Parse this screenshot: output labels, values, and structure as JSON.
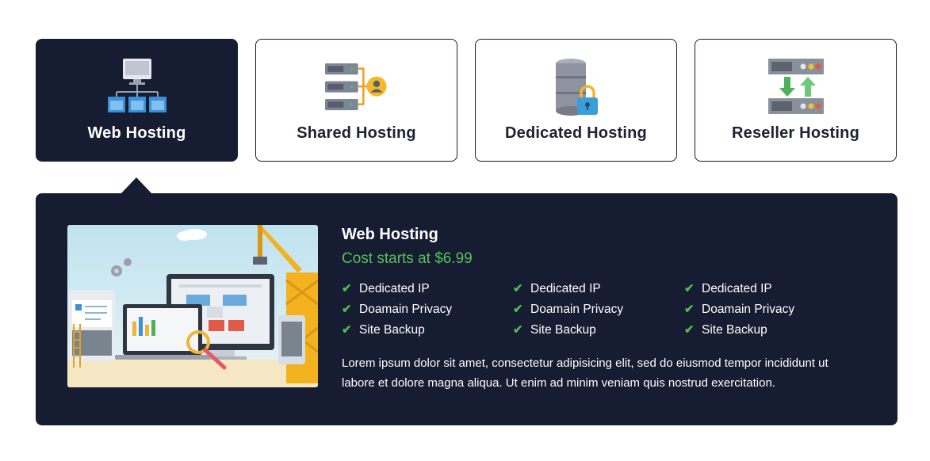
{
  "tabs": [
    {
      "label": "Web Hosting",
      "icon": "web-hosting-network-icon",
      "active": true
    },
    {
      "label": "Shared Hosting",
      "icon": "shared-hosting-servers-user-icon",
      "active": false
    },
    {
      "label": "Dedicated Hosting",
      "icon": "dedicated-hosting-database-lock-icon",
      "active": false
    },
    {
      "label": "Reseller Hosting",
      "icon": "reseller-hosting-transfer-icon",
      "active": false
    }
  ],
  "panel": {
    "title": "Web Hosting",
    "price": "Cost starts at $6.99",
    "image": "web-development-illustration",
    "features": [
      [
        "Dedicated IP",
        "Doamain Privacy",
        "Site Backup"
      ],
      [
        "Dedicated IP",
        "Doamain Privacy",
        "Site Backup"
      ],
      [
        "Dedicated IP",
        "Doamain Privacy",
        "Site Backup"
      ]
    ],
    "description": "Lorem ipsum dolor sit amet, consectetur adipisicing elit, sed do eiusmod tempor incididunt ut labore et dolore magna aliqua. Ut enim ad minim veniam quis nostrud exercitation."
  },
  "colors": {
    "dark": "#161c31",
    "accent_green": "#57c15a"
  }
}
